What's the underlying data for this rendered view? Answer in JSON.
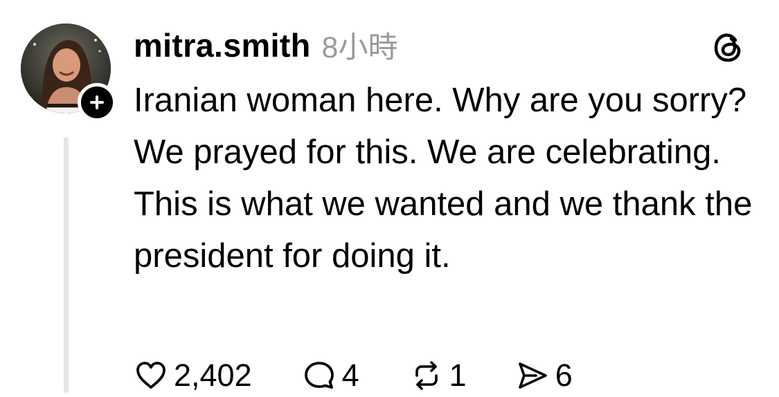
{
  "post": {
    "username": "mitra.smith",
    "timestamp": "8小時",
    "text": "Iranian woman here.  Why are you sorry? We prayed for this. We are celebrating. This is what we wanted and we thank the president for doing it.",
    "actions": {
      "likes": "2,402",
      "replies": "4",
      "reposts": "1",
      "shares": "6"
    }
  },
  "icons": {
    "follow": "plus-icon",
    "logo": "threads-logo-icon",
    "like": "heart-icon",
    "reply": "comment-bubble-icon",
    "repost": "repost-arrows-icon",
    "share": "send-icon"
  },
  "colors": {
    "text": "#000000",
    "muted": "#9a9a9a",
    "thread_line": "#e6e6e6",
    "background": "#ffffff"
  }
}
